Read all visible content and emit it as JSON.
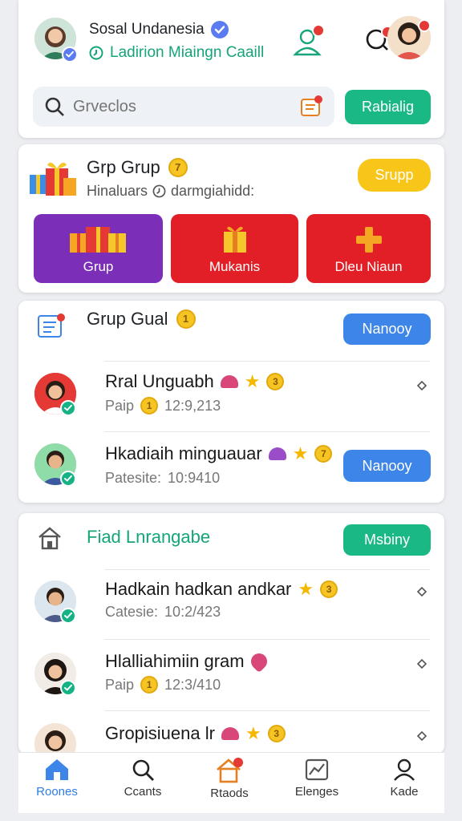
{
  "header": {
    "name": "Sosal Undanesia",
    "subtitle": "Ladirion Miaingn Caaill"
  },
  "search": {
    "placeholder": "Grveclos",
    "button_label": "Rabialig"
  },
  "group_card": {
    "title": "Grp Grup",
    "coin": "7",
    "subtitle": "Hinaluars",
    "subtitle_tag": "darmgiahidd:",
    "button_label": "Srupp",
    "tiles": [
      {
        "label": "Grup",
        "color": "#7b2fb8"
      },
      {
        "label": "Mukanis",
        "color": "#e21f26"
      },
      {
        "label": "Dleu Niaun",
        "color": "#e21f26"
      }
    ]
  },
  "feed_card": {
    "title": "Grup Gual",
    "coin": "1",
    "button_label": "Nanooy",
    "rows": [
      {
        "title": "Rral Unguabh",
        "coin": "3",
        "sub_label": "Paip",
        "sub_coin": "1",
        "time": "12:9,213"
      },
      {
        "title": "Hkadiaih minguauar",
        "coin": "7",
        "sub_label": "Patesite:",
        "time": "10:9410",
        "button_label": "Nanooy"
      }
    ]
  },
  "friends_card": {
    "title": "Fiad Lnrangabe",
    "button_label": "Msbiny",
    "rows": [
      {
        "title": "Hadkain hadkan andkar",
        "coin": "3",
        "sub_label": "Catesie:",
        "time": "10:2/423"
      },
      {
        "title": "Hlalliahimiin gram",
        "sub_label": "Paip",
        "sub_coin": "1",
        "time": "12:3/410"
      },
      {
        "title": "Gropisiuena lr",
        "coin": "3"
      }
    ]
  },
  "bottom_nav": [
    {
      "label": "Roones",
      "icon": "home-icon"
    },
    {
      "label": "Ccants",
      "icon": "search-icon"
    },
    {
      "label": "Rtaods",
      "icon": "house-icon"
    },
    {
      "label": "Elenges",
      "icon": "chart-icon"
    },
    {
      "label": "Kade",
      "icon": "profile-icon"
    }
  ],
  "colors": {
    "accent_green": "#19b884",
    "accent_blue": "#3d85e8",
    "badge_red": "#e53935",
    "verified_blue": "#5b7cf0",
    "active_nav": "#2f7de0"
  },
  "icons": {
    "subtitle_icon": "clock-icon",
    "add_user": "add-user-icon",
    "chat": "chat-icon",
    "notes": "notes-icon",
    "gift": "gift-icon",
    "feed_header": "document-icon",
    "friends_header": "house-outline-icon",
    "row_action": "chevron-icon"
  }
}
